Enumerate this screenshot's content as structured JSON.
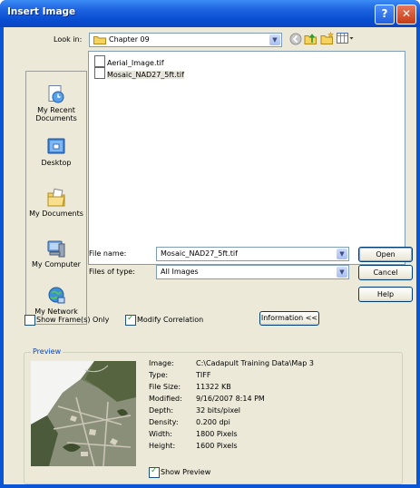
{
  "window": {
    "title": "Insert Image"
  },
  "lookin": {
    "label": "Look in:",
    "value": "Chapter 09"
  },
  "places": [
    {
      "label": "My Recent Documents"
    },
    {
      "label": "Desktop"
    },
    {
      "label": "My Documents"
    },
    {
      "label": "My Computer"
    },
    {
      "label": "My Network"
    }
  ],
  "files": [
    {
      "name": "Aerial_Image.tif",
      "selected": false
    },
    {
      "name": "Mosaic_NAD27_5ft.tif",
      "selected": true
    }
  ],
  "filename": {
    "label": "File name:",
    "value": "Mosaic_NAD27_5ft.tif"
  },
  "filetype": {
    "label": "Files of type:",
    "value": "All Images"
  },
  "buttons": {
    "open": "Open",
    "cancel": "Cancel",
    "help": "Help",
    "information": "Information <<"
  },
  "options": {
    "show_frames": "Show Frame(s) Only",
    "modify_correlation": "Modify Correlation"
  },
  "preview": {
    "title": "Preview",
    "show_preview": "Show Preview",
    "info": [
      {
        "key": "Image:",
        "value": "C:\\Cadapult Training Data\\Map 3"
      },
      {
        "key": "Type:",
        "value": "TIFF"
      },
      {
        "key": "File Size:",
        "value": "11322 KB"
      },
      {
        "key": "Modified:",
        "value": "9/16/2007 8:14 PM"
      },
      {
        "key": "Depth:",
        "value": "32 bits/pixel"
      },
      {
        "key": "Density:",
        "value": "0.200 dpi"
      },
      {
        "key": "Width:",
        "value": "1800 Pixels"
      },
      {
        "key": "Height:",
        "value": "1600 Pixels"
      }
    ]
  },
  "colors": {
    "title_bar": "#0a54d6",
    "dialog_bg": "#ece9d8",
    "accent": "#0046d5"
  }
}
